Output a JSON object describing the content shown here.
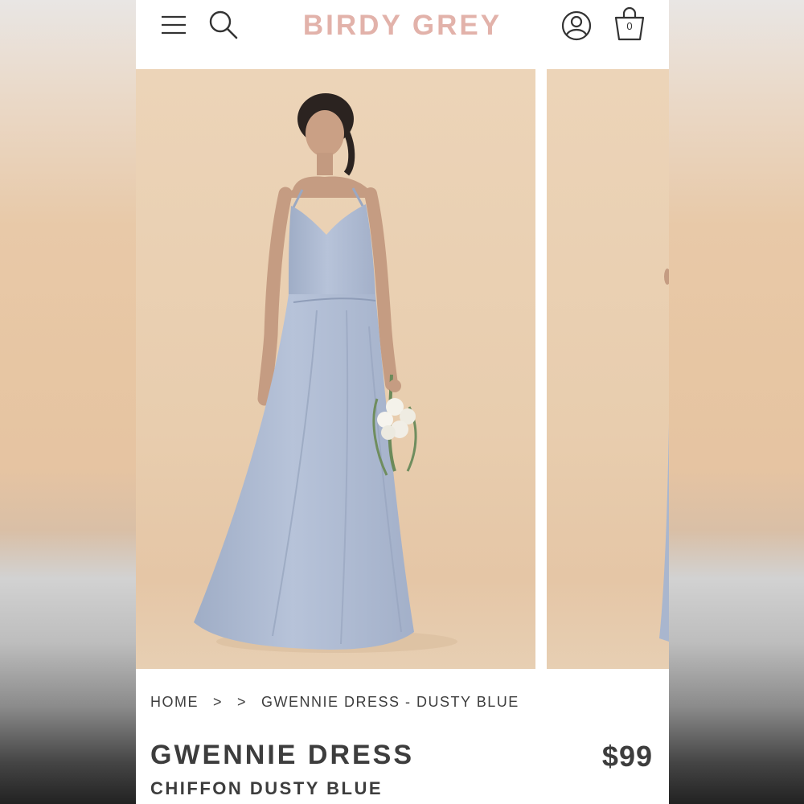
{
  "header": {
    "logo": "BIRDY GREY",
    "cart_count": "0",
    "icons": [
      "menu-icon",
      "search-icon",
      "account-icon",
      "shopping-bag-icon"
    ]
  },
  "breadcrumb": {
    "home": "HOME",
    "separator": ">",
    "current": "GWENNIE DRESS - DUSTY BLUE"
  },
  "product": {
    "name": "GWENNIE DRESS",
    "subtitle": "CHIFFON DUSTY BLUE",
    "price": "$99"
  },
  "colors": {
    "brand": "#e2b2aa",
    "text": "#3d3d3d",
    "photo_backdrop": "#e8cdae",
    "dress": "#aebbd3"
  }
}
